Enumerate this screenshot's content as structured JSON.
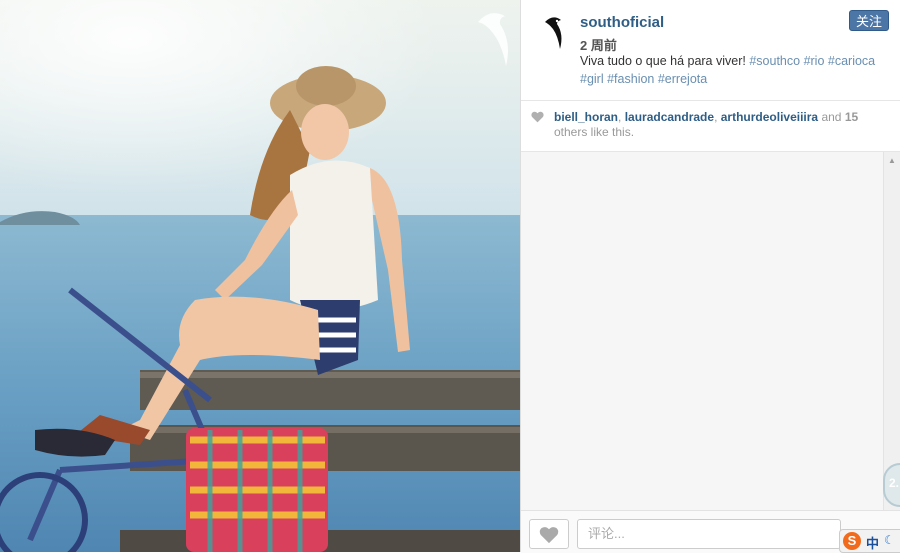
{
  "post": {
    "username": "southoficial",
    "time_ago": "2 周前",
    "caption_text": "Viva tudo o que há para viver!",
    "hashtags": [
      "#southco",
      "#rio",
      "#carioca",
      "#girl",
      "#fashion",
      "#errejota"
    ]
  },
  "follow_label": "关注",
  "likes": {
    "users": [
      "biell_horan",
      "lauradcandrade",
      "arthurdeoliveiiira"
    ],
    "sep": ", ",
    "and_text": "and",
    "others_count": "15",
    "suffix": "others like this."
  },
  "comment": {
    "placeholder": "评论..."
  },
  "ime": {
    "logo": "S",
    "label": "中"
  },
  "float_badge": "2.",
  "icons": {
    "avatar": "bird-logo",
    "photo_watermark": "bird-watermark-icon",
    "likes_heart": "heart-icon",
    "like_button": "heart-icon",
    "scroll_up": "triangle-up-icon",
    "scroll_down": "triangle-down-icon"
  },
  "colors": {
    "link": "#2e5e86",
    "hashtag": "#6a8fb0",
    "follow_bg": "#4b76a6",
    "ime_orange": "#f26a1b"
  }
}
